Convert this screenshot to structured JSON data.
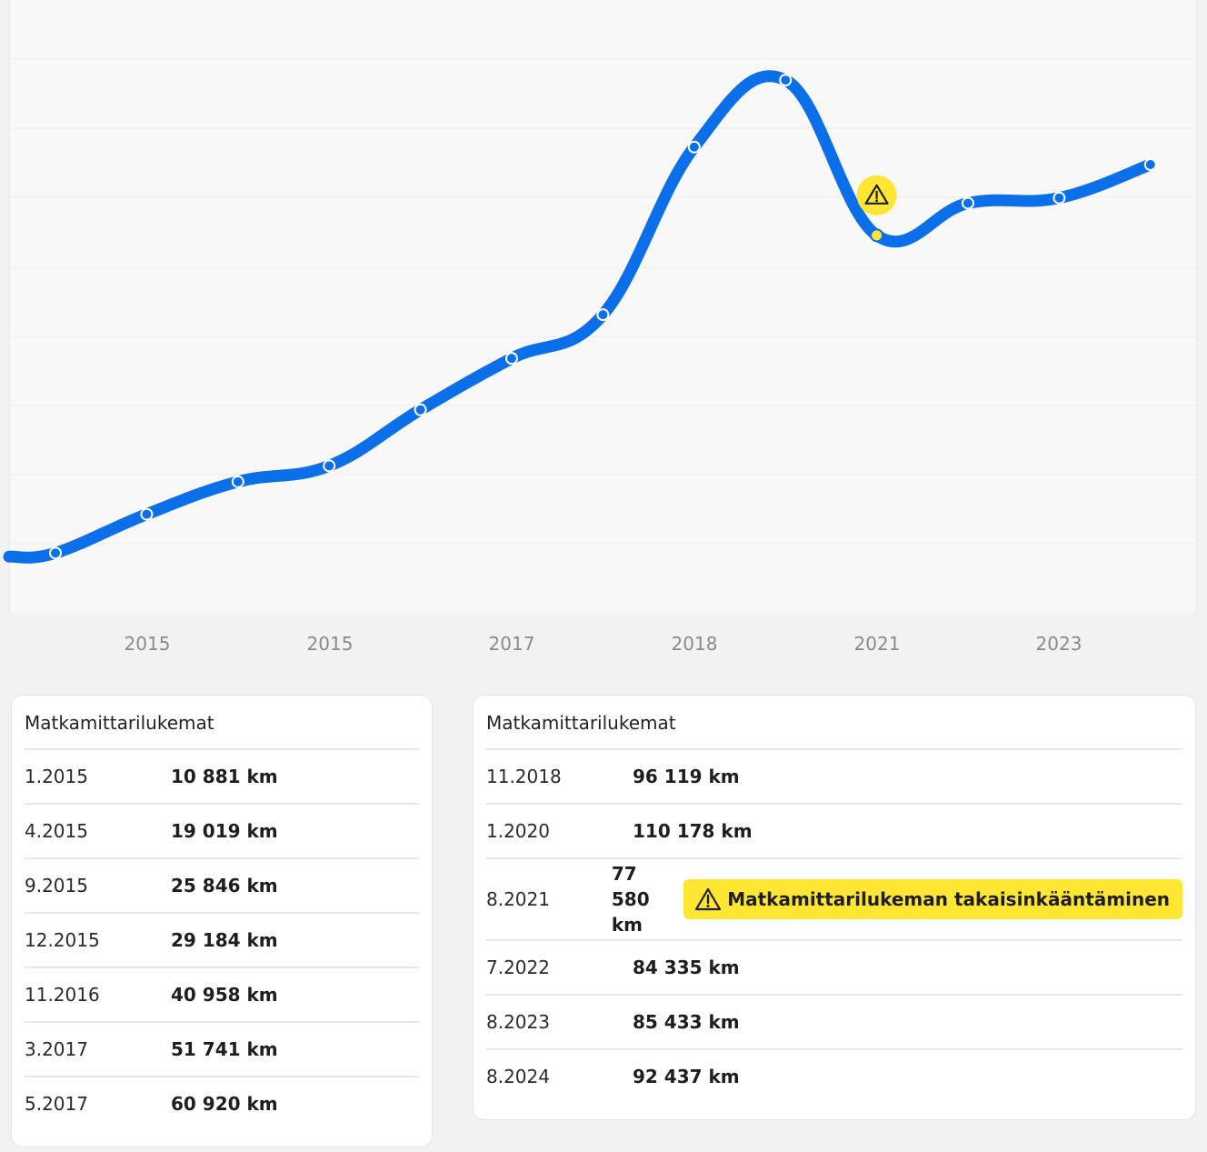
{
  "chart_data": {
    "type": "line",
    "x_tick_labels": [
      "2015",
      "2015",
      "2017",
      "2018",
      "2021",
      "2023"
    ],
    "points": [
      {
        "date": "1.2015",
        "km": 10881
      },
      {
        "date": "4.2015",
        "km": 19019
      },
      {
        "date": "9.2015",
        "km": 25846
      },
      {
        "date": "12.2015",
        "km": 29184
      },
      {
        "date": "11.2016",
        "km": 40958
      },
      {
        "date": "3.2017",
        "km": 51741
      },
      {
        "date": "5.2017",
        "km": 60920
      },
      {
        "date": "11.2018",
        "km": 96119
      },
      {
        "date": "1.2020",
        "km": 110178
      },
      {
        "date": "8.2021",
        "km": 77580,
        "warning": true
      },
      {
        "date": "7.2022",
        "km": 84335
      },
      {
        "date": "8.2023",
        "km": 85433
      },
      {
        "date": "8.2024",
        "km": 92437
      }
    ],
    "line_color": "#0a6fe8",
    "warning_color": "#ffe633",
    "grid": true,
    "warning_icon": "warning-triangle-icon"
  },
  "tables": {
    "left": {
      "title": "Matkamittarilukemat",
      "rows": [
        {
          "date": "1.2015",
          "km": "10 881 km"
        },
        {
          "date": "4.2015",
          "km": "19 019 km"
        },
        {
          "date": "9.2015",
          "km": "25 846 km"
        },
        {
          "date": "12.2015",
          "km": "29 184 km"
        },
        {
          "date": "11.2016",
          "km": "40 958 km"
        },
        {
          "date": "3.2017",
          "km": "51 741 km"
        },
        {
          "date": "5.2017",
          "km": "60 920 km"
        }
      ]
    },
    "right": {
      "title": "Matkamittarilukemat",
      "rows": [
        {
          "date": "11.2018",
          "km": "96 119 km"
        },
        {
          "date": "1.2020",
          "km": "110 178 km"
        },
        {
          "date": "8.2021",
          "km": "77 580 km",
          "warning": "Matkamittarilukeman takaisinkääntäminen"
        },
        {
          "date": "7.2022",
          "km": "84 335 km"
        },
        {
          "date": "8.2023",
          "km": "85 433 km"
        },
        {
          "date": "8.2024",
          "km": "92 437 km"
        }
      ]
    }
  }
}
